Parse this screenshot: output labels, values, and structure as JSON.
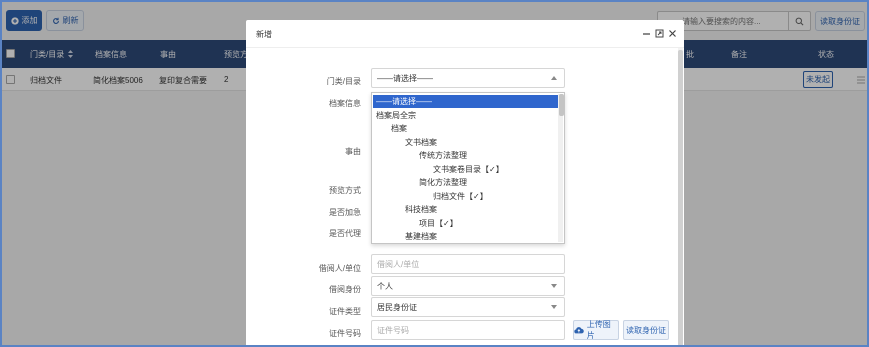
{
  "toolbar": {
    "add_label": "添加",
    "refresh_label": "刷新",
    "search_placeholder": "请输入要搜索的内容...",
    "read_id_label": "读取身份证"
  },
  "table": {
    "columns": [
      "门类/目录",
      "档案信息",
      "事由",
      "预览方",
      "批",
      "备注",
      "状态"
    ],
    "rows": [
      {
        "category": "归档文件",
        "info": "简化档案5006",
        "reason": "复印复合需要",
        "preview": "2",
        "status": "未发起"
      }
    ]
  },
  "modal": {
    "title": "新增",
    "fields": {
      "category_label": "门类/目录",
      "category_value": "——请选择——",
      "archive_label": "档案信息",
      "reason_label": "事由",
      "preview_label": "预览方式",
      "urgent_label": "是否加急",
      "proxy_label": "是否代理",
      "borrower_label": "借阅人/单位",
      "borrower_placeholder": "借阅人/单位",
      "identity_label": "借阅身份",
      "identity_value": "个人",
      "cert_type_label": "证件类型",
      "cert_type_value": "居民身份证",
      "cert_no_label": "证件号码",
      "cert_no_placeholder": "证件号码"
    },
    "dropdown_options": [
      {
        "label": "——请选择——",
        "level": 0,
        "selected": true
      },
      {
        "label": "档案局全宗",
        "level": 0
      },
      {
        "label": "档案",
        "level": 1
      },
      {
        "label": "文书档案",
        "level": 2
      },
      {
        "label": "传统方法整理",
        "level": 3
      },
      {
        "label": "文书案卷目录【✓】",
        "level": 4
      },
      {
        "label": "简化方法整理",
        "level": 3
      },
      {
        "label": "归档文件【✓】",
        "level": 4
      },
      {
        "label": "科技档案",
        "level": 2
      },
      {
        "label": "项目【✓】",
        "level": 3
      },
      {
        "label": "基建档案",
        "level": 2
      }
    ],
    "upload_label": "上传图片",
    "read_id_label": "读取身份证"
  },
  "colors": {
    "accent": "#2e63b0",
    "header_bg": "#2e4a79",
    "selected_option": "#2f66cd",
    "frame_border": "#5a83c4"
  }
}
